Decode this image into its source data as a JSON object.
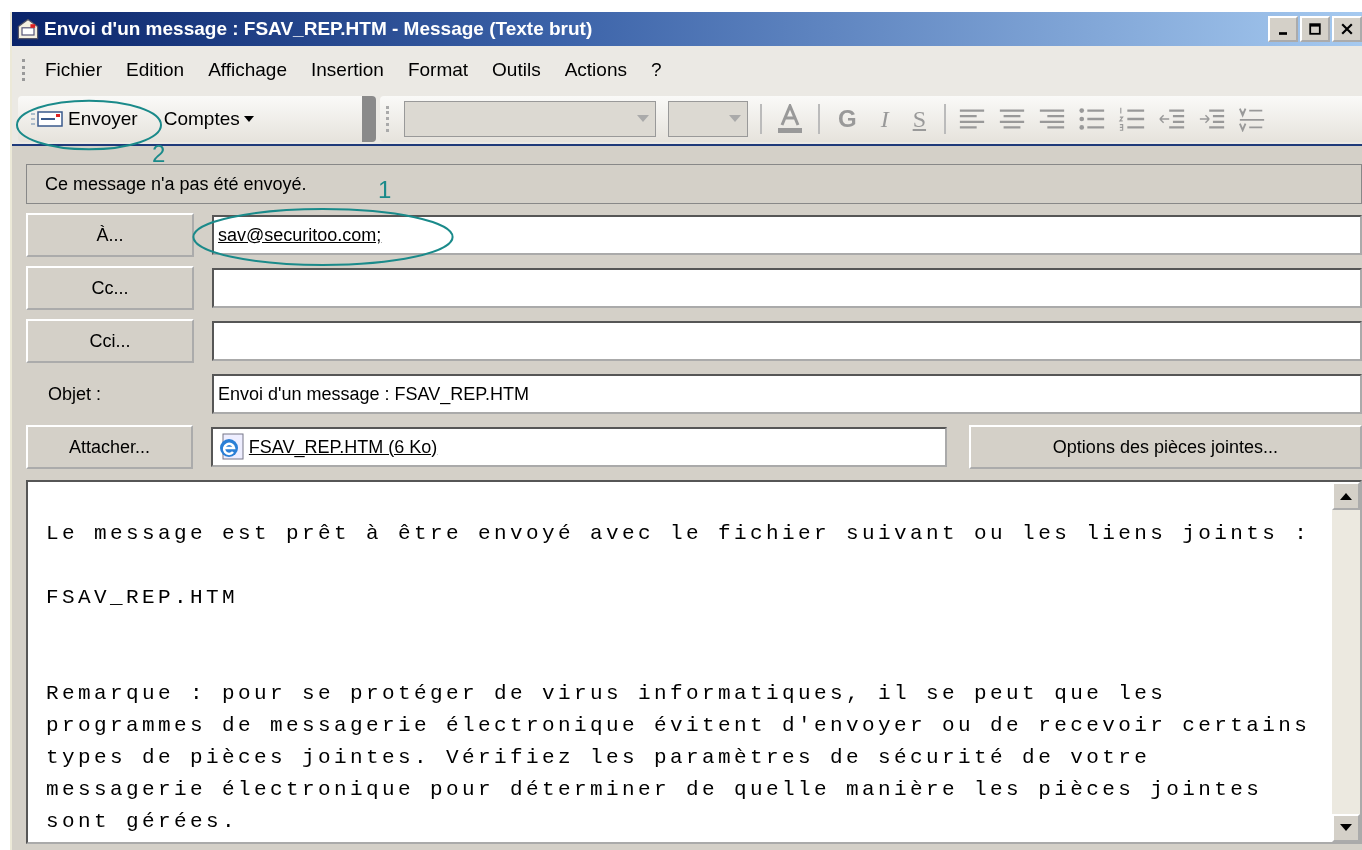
{
  "window": {
    "title": "Envoi d'un message : FSAV_REP.HTM - Message (Texte brut)"
  },
  "menu": [
    "Fichier",
    "Edition",
    "Affichage",
    "Insertion",
    "Format",
    "Outils",
    "Actions",
    "?"
  ],
  "toolbar": {
    "send": "Envoyer",
    "accounts": "Comptes",
    "format_letters": [
      "G",
      "I",
      "S"
    ]
  },
  "info_bar": "Ce message n'a pas été envoyé.",
  "fields": [
    {
      "kind": "button",
      "label": "À...",
      "value": "sav@securitoo.com;"
    },
    {
      "kind": "button",
      "label": "Cc..."
    },
    {
      "kind": "button",
      "label": "Cci..."
    },
    {
      "kind": "label",
      "label": "Objet :",
      "value": "Envoi d'un message : FSAV_REP.HTM"
    }
  ],
  "attachment": {
    "button": "Attacher...",
    "file": "FSAV_REP.HTM (6 Ko)",
    "options": "Options des pièces jointes..."
  },
  "body": "Le message est prêt à être envoyé avec le fichier suivant ou les liens joints :\n\nFSAV_REP.HTM\n\n\nRemarque : pour se protéger de virus informatiques, il se peut que les\nprogrammes de messagerie électronique évitent d'envoyer ou de recevoir certains\ntypes de pièces jointes. Vérifiez les paramètres de sécurité de votre\nmessagerie électronique pour déterminer de quelle manière les pièces jointes\nsont gérées.",
  "annotations": [
    {
      "label": "2"
    },
    {
      "label": "1"
    }
  ]
}
